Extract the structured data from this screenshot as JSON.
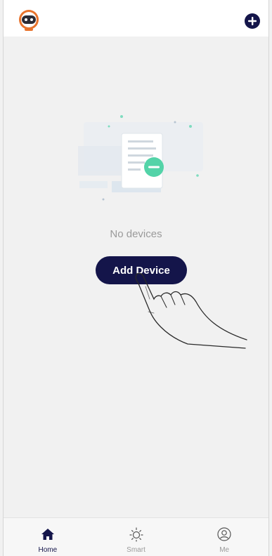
{
  "header": {
    "avatar_icon": "robot-avatar-icon",
    "add_icon": "plus-circle-icon"
  },
  "empty_state": {
    "illustration_icon": "empty-document-icon",
    "message": "No devices",
    "add_device_label": "Add Device"
  },
  "tabbar": {
    "items": [
      {
        "label": "Home",
        "icon": "home-icon",
        "active": true
      },
      {
        "label": "Smart",
        "icon": "sun-icon",
        "active": false
      },
      {
        "label": "Me",
        "icon": "user-circle-icon",
        "active": false
      }
    ]
  },
  "colors": {
    "accent": "#14154a",
    "avatar_ring": "#e8732c",
    "background": "#f1f1f1",
    "illustration_mint": "#53d3a8"
  }
}
